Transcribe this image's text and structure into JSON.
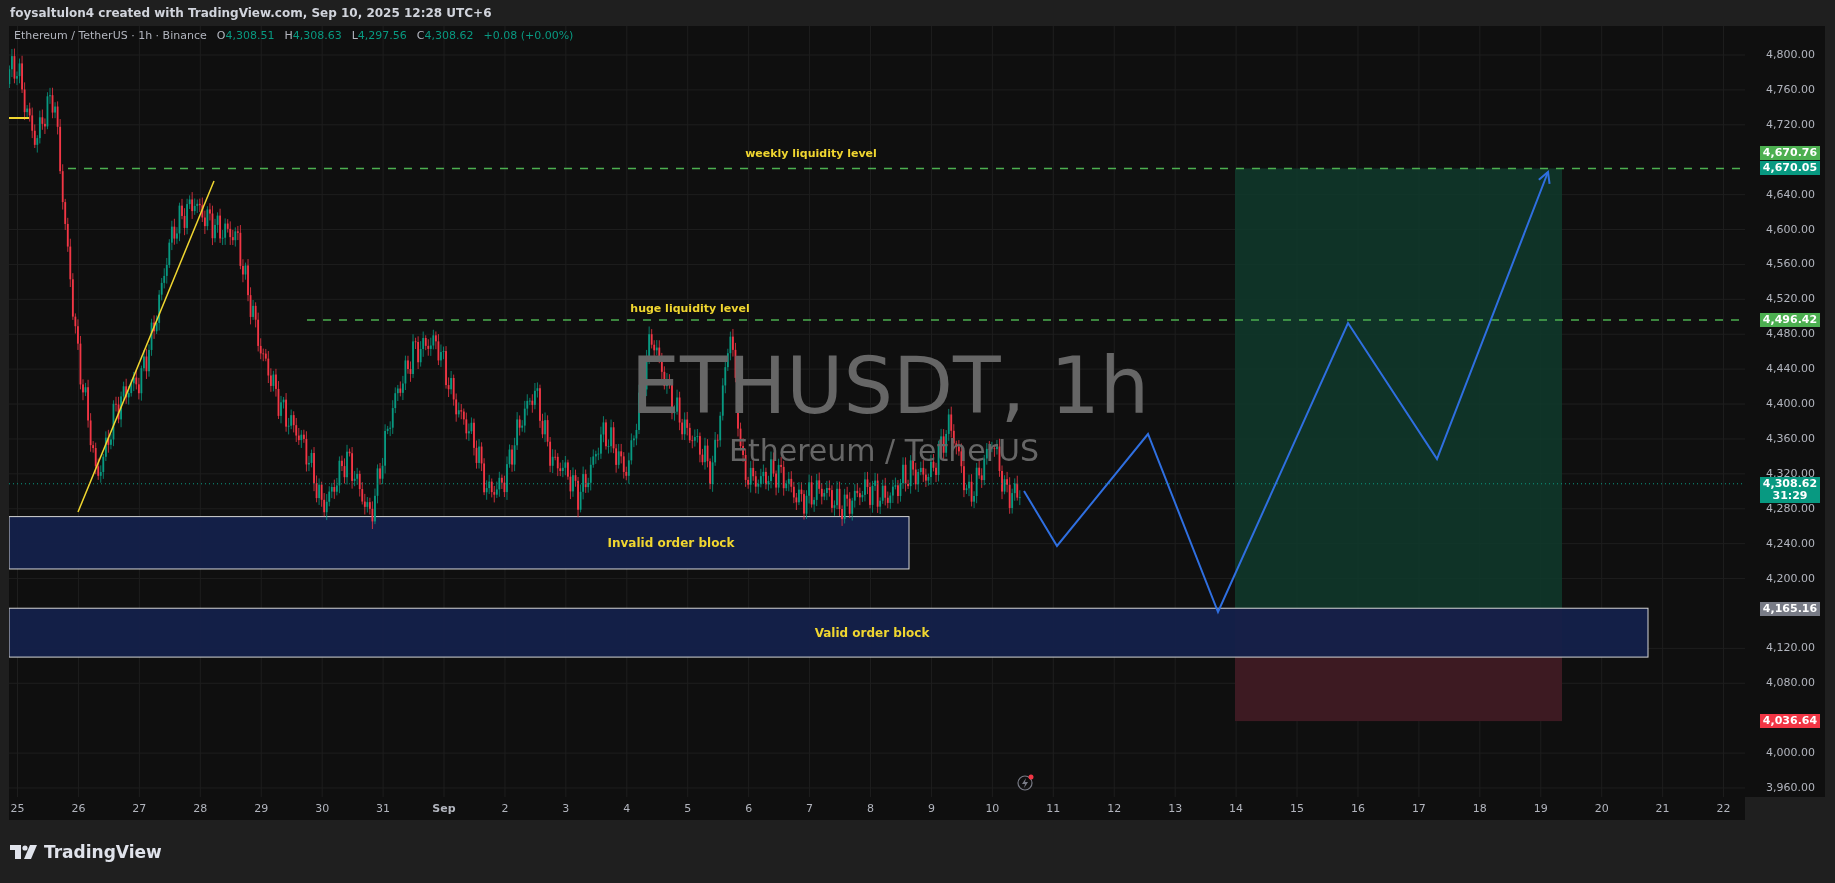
{
  "header": {
    "text": "foysaltulon4 created with TradingView.com, Sep 10, 2025 12:28 UTC+6"
  },
  "legend": {
    "symbol": "Ethereum / TetherUS · 1h · Binance",
    "ohlc": [
      {
        "key": "O",
        "value": "4,308.51"
      },
      {
        "key": "H",
        "value": "4,308.63"
      },
      {
        "key": "L",
        "value": "4,297.56"
      },
      {
        "key": "C",
        "value": "4,308.62"
      }
    ],
    "change": "+0.08 (+0.00%)"
  },
  "symbol_watermark": {
    "title": "ETHUSDT, 1h",
    "subtitle": "Ethereum / TetherUS"
  },
  "levels": [
    {
      "label": "weekly liquidity level"
    },
    {
      "label": "huge liquidity level"
    }
  ],
  "zones": [
    {
      "label": "Invalid order block"
    },
    {
      "label": "Valid order block"
    }
  ],
  "price_axis": {
    "ticks": [
      "4,800.00",
      "4,760.00",
      "4,720.00",
      "4,640.00",
      "4,600.00",
      "4,560.00",
      "4,520.00",
      "4,480.00",
      "4,440.00",
      "4,400.00",
      "4,360.00",
      "4,320.00",
      "4,280.00",
      "4,240.00",
      "4,200.00",
      "4,120.00",
      "4,080.00",
      "4,000.00",
      "3,960.00"
    ],
    "tags": [
      {
        "text": "4,670.76",
        "color": "#4caf50"
      },
      {
        "text": "4,670.05",
        "color": "#089981"
      },
      {
        "text": "4,496.42",
        "color": "#4caf50"
      },
      {
        "text": "4,308.62",
        "countdown": "31:29",
        "color": "#089981"
      },
      {
        "text": "4,165.16",
        "color": "#787b86"
      },
      {
        "text": "4,036.64",
        "color": "#f23645"
      }
    ]
  },
  "time_axis": [
    "25",
    "26",
    "27",
    "28",
    "29",
    "30",
    "31",
    "Sep",
    "2",
    "3",
    "4",
    "5",
    "6",
    "7",
    "8",
    "9",
    "10",
    "11",
    "12",
    "13",
    "14",
    "15",
    "16",
    "17",
    "18",
    "19",
    "20",
    "21",
    "22"
  ],
  "footer": {
    "brand": "TradingView"
  }
}
